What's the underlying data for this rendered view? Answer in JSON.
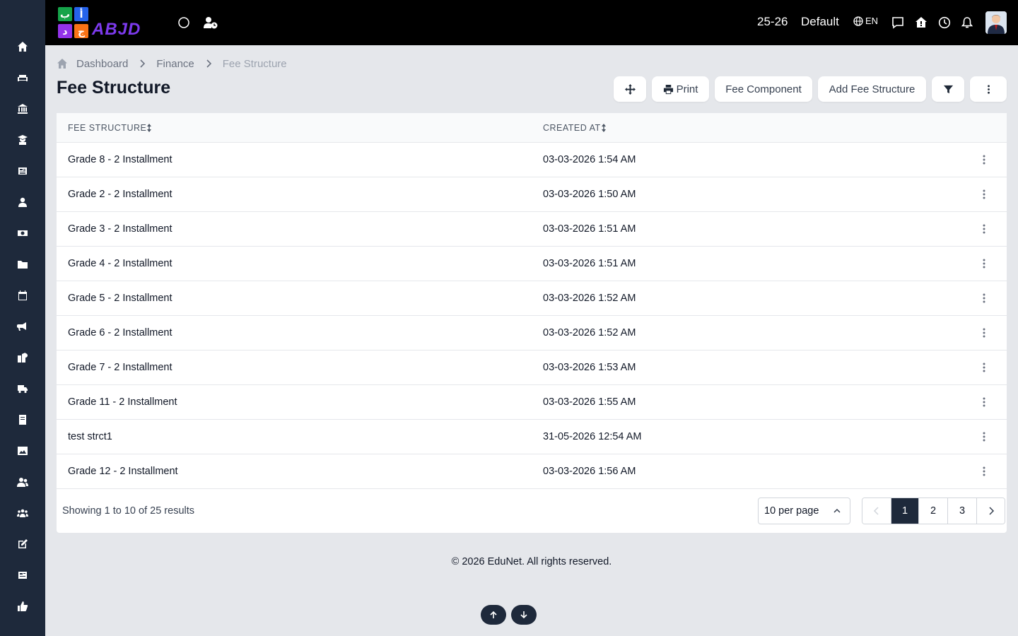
{
  "topbar": {
    "logo_text": "ABJD",
    "logo_letters": [
      "ب",
      "أ",
      "د",
      "ج"
    ],
    "academic_year": "25-26",
    "profile_name": "Default",
    "language": "EN"
  },
  "breadcrumb": {
    "items": [
      "Dashboard",
      "Finance",
      "Fee Structure"
    ]
  },
  "page": {
    "title": "Fee Structure"
  },
  "toolbar": {
    "print_label": "Print",
    "fee_component_label": "Fee Component",
    "add_label": "Add Fee Structure"
  },
  "table": {
    "columns": [
      "FEE STRUCTURE",
      "CREATED AT"
    ],
    "rows": [
      {
        "name": "Grade 8 - 2 Installment",
        "created": "03-03-2026 1:54 AM"
      },
      {
        "name": "Grade 2 - 2 Installment",
        "created": "03-03-2026 1:50 AM"
      },
      {
        "name": "Grade 3 - 2 Installment",
        "created": "03-03-2026 1:51 AM"
      },
      {
        "name": "Grade 4 - 2 Installment",
        "created": "03-03-2026 1:51 AM"
      },
      {
        "name": "Grade 5 - 2 Installment",
        "created": "03-03-2026 1:52 AM"
      },
      {
        "name": "Grade 6 - 2 Installment",
        "created": "03-03-2026 1:52 AM"
      },
      {
        "name": "Grade 7 - 2 Installment",
        "created": "03-03-2026 1:53 AM"
      },
      {
        "name": "Grade 11 - 2 Installment",
        "created": "03-03-2026 1:55 AM"
      },
      {
        "name": "test strct1",
        "created": "31-05-2026 12:54 AM"
      },
      {
        "name": "Grade 12 - 2 Installment",
        "created": "03-03-2026 1:56 AM"
      }
    ]
  },
  "pagination": {
    "summary": "Showing 1 to 10 of 25 results",
    "per_page": "10 per page",
    "pages": [
      "1",
      "2",
      "3"
    ],
    "current_page": "1"
  },
  "footer": {
    "copyright": "© 2026 EduNet. All rights reserved."
  },
  "colors": {
    "sidebar": "#1e293b",
    "topbar": "#000000",
    "background": "#e5e7eb",
    "accent": "#1e293b"
  },
  "sidebar_icons": [
    "home-icon",
    "sofa-icon",
    "bank-icon",
    "graduate-icon",
    "newspaper-icon",
    "user-tie-icon",
    "money-icon",
    "folder-icon",
    "calendar-icon",
    "megaphone-icon",
    "school-icon",
    "truck-icon",
    "book-icon",
    "image-icon",
    "users-icon",
    "group-icon",
    "edit-icon",
    "report-icon",
    "thumbs-up-icon"
  ]
}
